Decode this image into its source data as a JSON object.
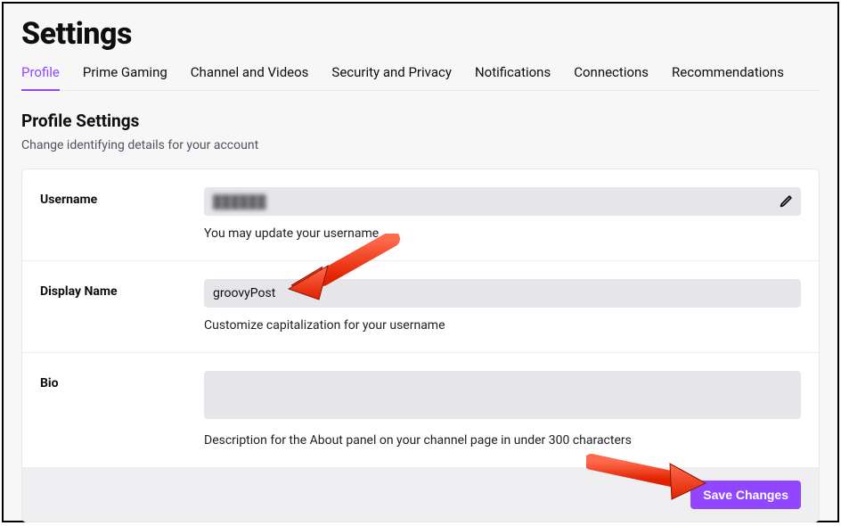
{
  "page_title": "Settings",
  "tabs": [
    {
      "label": "Profile",
      "active": true
    },
    {
      "label": "Prime Gaming",
      "active": false
    },
    {
      "label": "Channel and Videos",
      "active": false
    },
    {
      "label": "Security and Privacy",
      "active": false
    },
    {
      "label": "Notifications",
      "active": false
    },
    {
      "label": "Connections",
      "active": false
    },
    {
      "label": "Recommendations",
      "active": false
    }
  ],
  "section": {
    "heading": "Profile Settings",
    "sub": "Change identifying details for your account"
  },
  "fields": {
    "username": {
      "label": "Username",
      "value": "██████",
      "help": "You may update your username"
    },
    "display_name": {
      "label": "Display Name",
      "value": "groovyPost",
      "help": "Customize capitalization for your username"
    },
    "bio": {
      "label": "Bio",
      "value": "",
      "help": "Description for the About panel on your channel page in under 300 characters"
    }
  },
  "footer": {
    "save_label": "Save Changes"
  }
}
